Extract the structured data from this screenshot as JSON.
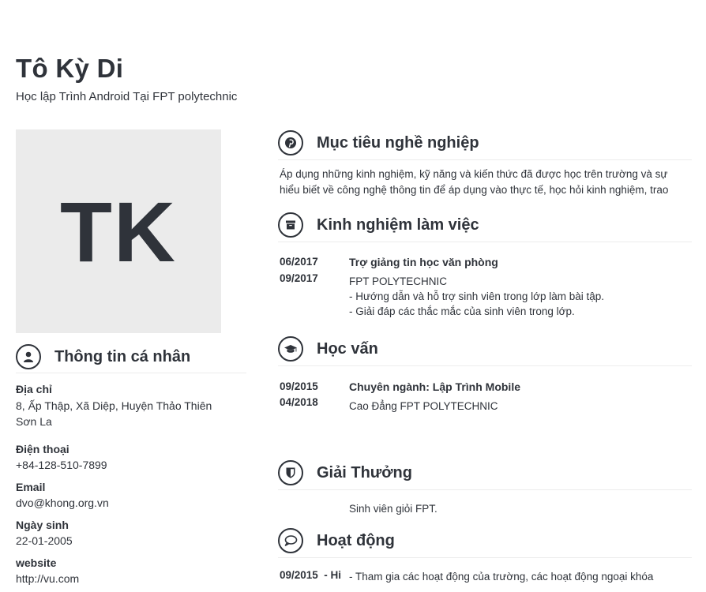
{
  "header": {
    "name": "Tô Kỳ Di",
    "subtitle": "Học lập Trình Android Tại FPT polytechnic"
  },
  "avatar": {
    "initials": "TK",
    "background": "#ebebeb"
  },
  "personal": {
    "section_title": "Thông tin cá nhân",
    "icon": "user-icon",
    "fields": [
      {
        "label": "Địa chỉ",
        "value_lines": [
          "8, Ấp Thập, Xã Diệp, Huyện Thảo Thiên",
          "Sơn La"
        ]
      },
      {
        "label": "Điện thoại",
        "value_lines": [
          "+84-128-510-7899"
        ]
      },
      {
        "label": "Email",
        "value_lines": [
          "dvo@khong.org.vn"
        ]
      },
      {
        "label": "Ngày sinh",
        "value_lines": [
          "22-01-2005"
        ]
      },
      {
        "label": "website",
        "value_lines": [
          "http://vu.com"
        ]
      }
    ]
  },
  "objective": {
    "section_title": "Mục tiêu nghề nghiệp",
    "icon": "pinterest-icon",
    "text": "Áp dụng những kinh nghiệm, kỹ năng và kiến thức đã được học trên trường và sự hiểu biết về công nghệ thông tin để áp dụng vào thực tế, học hỏi kinh nghiệm, trao"
  },
  "experience": {
    "section_title": "Kinh nghiệm làm việc",
    "icon": "archive-icon",
    "items": [
      {
        "start": "06/2017",
        "end": "09/2017",
        "title": "Trợ giảng tin học văn phòng",
        "lines": [
          "FPT POLYTECHNIC",
          "- Hướng dẫn và hỗ trợ sinh viên trong lớp làm bài tập.",
          "- Giải đáp các thắc mắc của sinh viên trong lớp."
        ]
      }
    ]
  },
  "education": {
    "section_title": "Học vấn",
    "icon": "graduation-cap-icon",
    "items": [
      {
        "start": "09/2015",
        "end": "04/2018",
        "title": "Chuyên ngành: Lập Trình Mobile",
        "lines": [
          "Cao Đẳng FPT POLYTECHNIC"
        ]
      }
    ]
  },
  "awards": {
    "section_title": "Giải Thưởng",
    "icon": "shield-icon",
    "items": [
      "Sinh viên giỏi FPT."
    ]
  },
  "activities": {
    "section_title": "Hoạt động",
    "icon": "speech-bubble-icon",
    "items": [
      {
        "date": "09/2015  - Hi",
        "text": "- Tham gia các hoạt động của trường, các hoạt động ngoại khóa"
      }
    ]
  }
}
